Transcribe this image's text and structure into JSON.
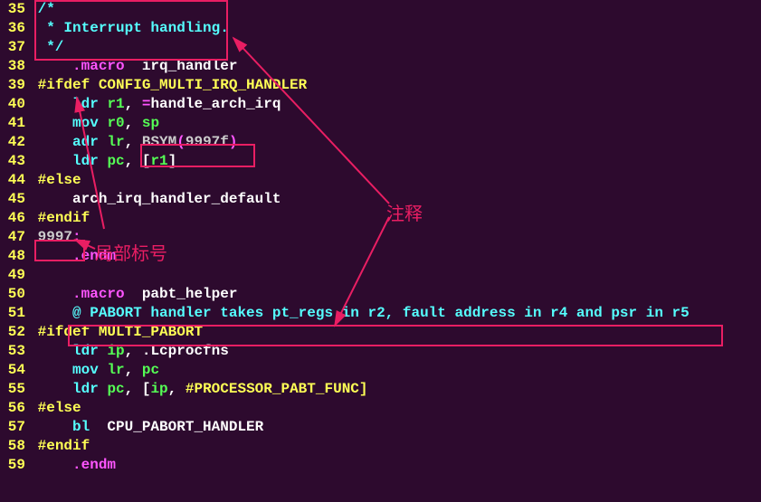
{
  "annotations": {
    "comment_label": "注释",
    "local_label": "局部标号"
  },
  "lines": [
    {
      "no": "35",
      "segments": [
        {
          "cls": "c-comment",
          "t": " /*"
        }
      ]
    },
    {
      "no": "36",
      "segments": [
        {
          "cls": "c-comment",
          "t": "  * Interrupt handling."
        }
      ]
    },
    {
      "no": "37",
      "segments": [
        {
          "cls": "c-comment",
          "t": "  */"
        }
      ]
    },
    {
      "no": "38",
      "segments": [
        {
          "cls": "c-white",
          "t": "     "
        },
        {
          "cls": "c-pink",
          "t": ".macro"
        },
        {
          "cls": "c-white",
          "t": "  irq_handler"
        }
      ]
    },
    {
      "no": "39",
      "segments": [
        {
          "cls": "c-white",
          "t": " "
        },
        {
          "cls": "c-keyword",
          "t": "#ifdef CONFIG_MULTI_IRQ_HANDLER"
        }
      ]
    },
    {
      "no": "40",
      "segments": [
        {
          "cls": "c-white",
          "t": "     "
        },
        {
          "cls": "c-cyan",
          "t": "ldr"
        },
        {
          "cls": "c-white",
          "t": " "
        },
        {
          "cls": "c-green",
          "t": "r1"
        },
        {
          "cls": "c-white",
          "t": ", "
        },
        {
          "cls": "c-pink",
          "t": "="
        },
        {
          "cls": "c-white",
          "t": "handle_arch_irq"
        }
      ]
    },
    {
      "no": "41",
      "segments": [
        {
          "cls": "c-white",
          "t": "     "
        },
        {
          "cls": "c-cyan",
          "t": "mov"
        },
        {
          "cls": "c-white",
          "t": " "
        },
        {
          "cls": "c-green",
          "t": "r0"
        },
        {
          "cls": "c-white",
          "t": ", "
        },
        {
          "cls": "c-green",
          "t": "sp"
        }
      ]
    },
    {
      "no": "42",
      "segments": [
        {
          "cls": "c-white",
          "t": "     "
        },
        {
          "cls": "c-cyan",
          "t": "adr"
        },
        {
          "cls": "c-white",
          "t": " "
        },
        {
          "cls": "c-green",
          "t": "lr"
        },
        {
          "cls": "c-white",
          "t": ", "
        },
        {
          "cls": "c-gray",
          "t": "BSYM"
        },
        {
          "cls": "c-pink",
          "t": "("
        },
        {
          "cls": "c-gray",
          "t": "9997f"
        },
        {
          "cls": "c-pink",
          "t": ")"
        }
      ]
    },
    {
      "no": "43",
      "segments": [
        {
          "cls": "c-white",
          "t": "     "
        },
        {
          "cls": "c-cyan",
          "t": "ldr"
        },
        {
          "cls": "c-white",
          "t": " "
        },
        {
          "cls": "c-green",
          "t": "pc"
        },
        {
          "cls": "c-white",
          "t": ", ["
        },
        {
          "cls": "c-green",
          "t": "r1"
        },
        {
          "cls": "c-white",
          "t": "]"
        }
      ]
    },
    {
      "no": "44",
      "segments": [
        {
          "cls": "c-white",
          "t": " "
        },
        {
          "cls": "c-keyword",
          "t": "#else"
        }
      ]
    },
    {
      "no": "45",
      "segments": [
        {
          "cls": "c-white",
          "t": "     arch_irq_handler_default"
        }
      ]
    },
    {
      "no": "46",
      "segments": [
        {
          "cls": "c-white",
          "t": " "
        },
        {
          "cls": "c-keyword",
          "t": "#endif"
        }
      ]
    },
    {
      "no": "47",
      "segments": [
        {
          "cls": "c-white",
          "t": " "
        },
        {
          "cls": "c-gray",
          "t": "9997"
        },
        {
          "cls": "c-pink",
          "t": ":"
        }
      ]
    },
    {
      "no": "48",
      "segments": [
        {
          "cls": "c-white",
          "t": "     "
        },
        {
          "cls": "c-pink",
          "t": ".endm"
        }
      ]
    },
    {
      "no": "49",
      "segments": []
    },
    {
      "no": "50",
      "segments": [
        {
          "cls": "c-white",
          "t": "     "
        },
        {
          "cls": "c-pink",
          "t": ".macro"
        },
        {
          "cls": "c-white",
          "t": "  pabt_helper"
        }
      ]
    },
    {
      "no": "51",
      "segments": [
        {
          "cls": "c-white",
          "t": "     "
        },
        {
          "cls": "c-comment",
          "t": "@ PABORT handler takes pt_regs in r2, fault address in r4 and psr in r5"
        }
      ]
    },
    {
      "no": "52",
      "segments": [
        {
          "cls": "c-white",
          "t": " "
        },
        {
          "cls": "c-keyword",
          "t": "#ifdef MULTI_PABORT"
        }
      ]
    },
    {
      "no": "53",
      "segments": [
        {
          "cls": "c-white",
          "t": "     "
        },
        {
          "cls": "c-cyan",
          "t": "ldr"
        },
        {
          "cls": "c-white",
          "t": " "
        },
        {
          "cls": "c-green",
          "t": "ip"
        },
        {
          "cls": "c-white",
          "t": ", .Lcprocfns"
        }
      ]
    },
    {
      "no": "54",
      "segments": [
        {
          "cls": "c-white",
          "t": "     "
        },
        {
          "cls": "c-cyan",
          "t": "mov"
        },
        {
          "cls": "c-white",
          "t": " "
        },
        {
          "cls": "c-green",
          "t": "lr"
        },
        {
          "cls": "c-white",
          "t": ", "
        },
        {
          "cls": "c-green",
          "t": "pc"
        }
      ]
    },
    {
      "no": "55",
      "segments": [
        {
          "cls": "c-white",
          "t": "     "
        },
        {
          "cls": "c-cyan",
          "t": "ldr"
        },
        {
          "cls": "c-white",
          "t": " "
        },
        {
          "cls": "c-green",
          "t": "pc"
        },
        {
          "cls": "c-white",
          "t": ", ["
        },
        {
          "cls": "c-green",
          "t": "ip"
        },
        {
          "cls": "c-white",
          "t": ", "
        },
        {
          "cls": "c-keyword",
          "t": "#PROCESSOR_PABT_FUNC]"
        }
      ]
    },
    {
      "no": "56",
      "segments": [
        {
          "cls": "c-white",
          "t": " "
        },
        {
          "cls": "c-keyword",
          "t": "#else"
        }
      ]
    },
    {
      "no": "57",
      "segments": [
        {
          "cls": "c-white",
          "t": "     "
        },
        {
          "cls": "c-cyan",
          "t": "bl"
        },
        {
          "cls": "c-white",
          "t": "  CPU_PABORT_HANDLER"
        }
      ]
    },
    {
      "no": "58",
      "segments": [
        {
          "cls": "c-white",
          "t": " "
        },
        {
          "cls": "c-keyword",
          "t": "#endif"
        }
      ]
    },
    {
      "no": "59",
      "segments": [
        {
          "cls": "c-white",
          "t": "     "
        },
        {
          "cls": "c-pink",
          "t": ".endm"
        }
      ]
    }
  ]
}
